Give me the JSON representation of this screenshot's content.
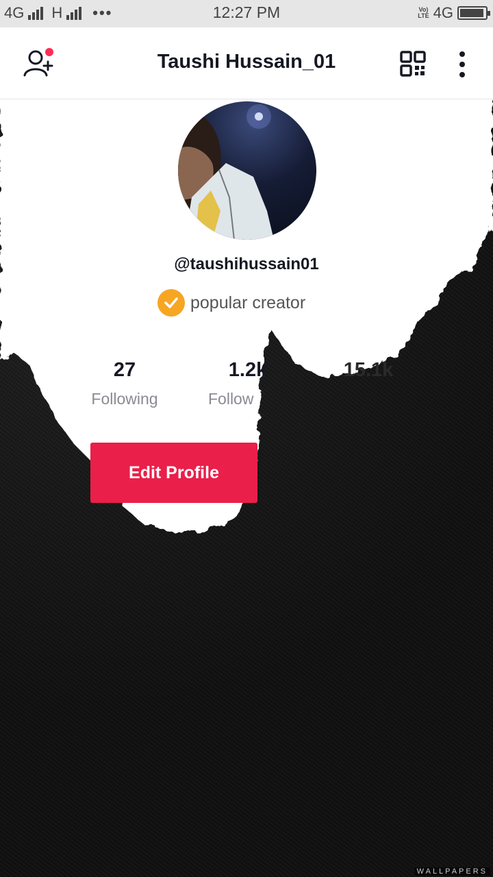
{
  "status_bar": {
    "network_1": "4G",
    "network_2": "H",
    "more": "•••",
    "time": "12:27 PM",
    "volte_line1": "Vo)",
    "volte_line2": "LTE",
    "network_right": "4G"
  },
  "header": {
    "title": "Taushi Hussain_01",
    "icons": [
      "add-user-icon",
      "qr-code-icon",
      "more-vertical-icon"
    ],
    "notification_dot_color": "#fe2c55"
  },
  "profile": {
    "handle": "@taushihussain01",
    "badge_label": "popular creator",
    "badge_color": "#f6a623"
  },
  "stats": [
    {
      "value": "27",
      "label": "Following"
    },
    {
      "value": "1.2k",
      "label": "Follow"
    },
    {
      "value": "15.1k",
      "label": ""
    }
  ],
  "actions": {
    "edit_profile": "Edit Profile",
    "accent": "#ea1f4a"
  },
  "watermark": "WALLPAPERS"
}
